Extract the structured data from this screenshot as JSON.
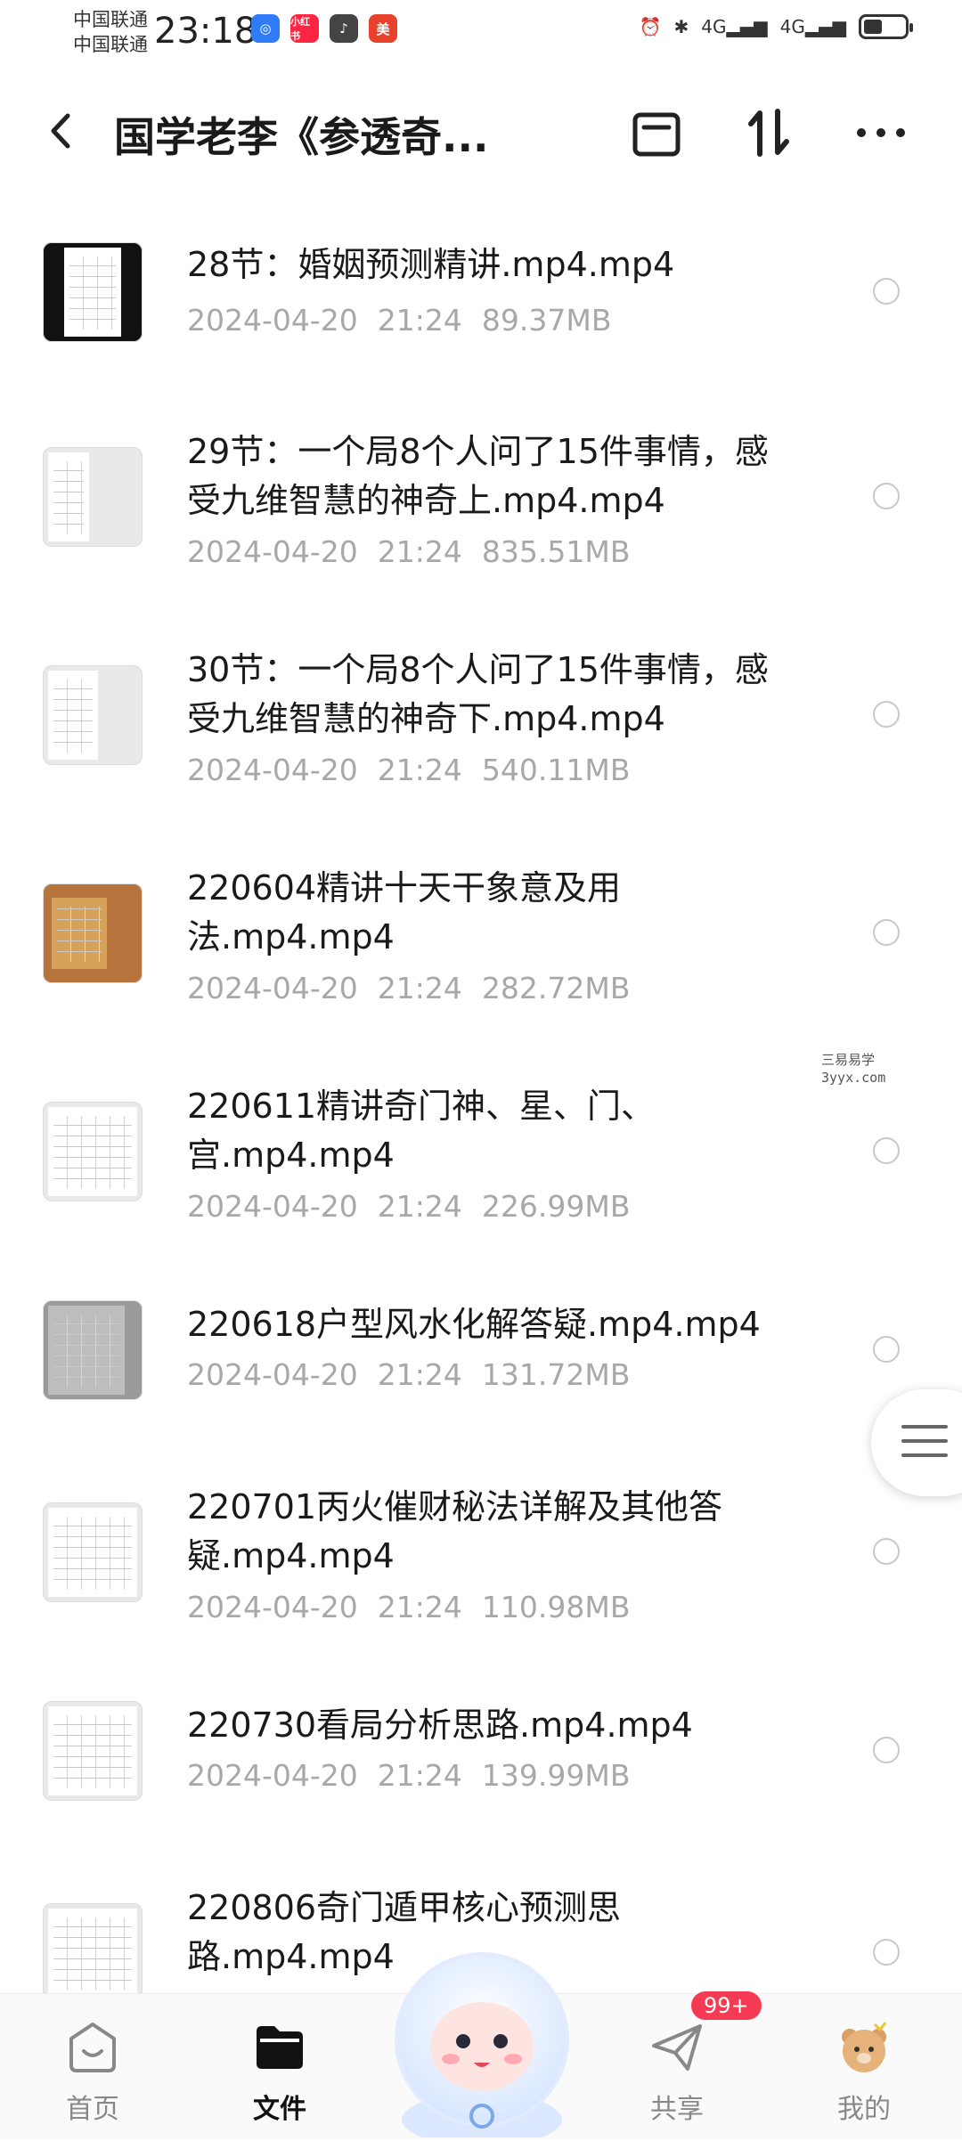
{
  "status_bar": {
    "carrier_1": "中国联通",
    "carrier_2": "中国联通",
    "time": "23:18",
    "app_badges": [
      "blue-app",
      "小红书",
      "tiktok-app",
      "美团"
    ],
    "net_1": "4G",
    "net_2": "4G"
  },
  "header": {
    "title": "国学老李《参透奇...",
    "icons": [
      "back-icon",
      "clipboard-icon",
      "sort-icon",
      "more-icon"
    ]
  },
  "files": [
    {
      "name": "28节：婚姻预测精讲.mp4.mp4",
      "date": "2024-04-20",
      "time": "21:24",
      "size": "89.37MB"
    },
    {
      "name": "29节：一个局8个人问了15件事情，感受九维智慧的神奇上.mp4.mp4",
      "date": "2024-04-20",
      "time": "21:24",
      "size": "835.51MB"
    },
    {
      "name": "30节：一个局8个人问了15件事情，感受九维智慧的神奇下.mp4.mp4",
      "date": "2024-04-20",
      "time": "21:24",
      "size": "540.11MB"
    },
    {
      "name": "220604精讲十天干象意及用法.mp4.mp4",
      "date": "2024-04-20",
      "time": "21:24",
      "size": "282.72MB"
    },
    {
      "name": "220611精讲奇门神、星、门、宫.mp4.mp4",
      "date": "2024-04-20",
      "time": "21:24",
      "size": "226.99MB"
    },
    {
      "name": "220618户型风水化解答疑.mp4.mp4",
      "date": "2024-04-20",
      "time": "21:24",
      "size": "131.72MB"
    },
    {
      "name": "220701丙火催财秘法详解及其他答疑.mp4.mp4",
      "date": "2024-04-20",
      "time": "21:24",
      "size": "110.98MB"
    },
    {
      "name": "220730看局分析思路.mp4.mp4",
      "date": "2024-04-20",
      "time": "21:24",
      "size": "139.99MB"
    },
    {
      "name": "220806奇门遁甲核心预测思路.mp4.mp4"
    }
  ],
  "watermark": {
    "line1": "三易易学",
    "line2": "3yyx.com"
  },
  "nav": {
    "home": "首页",
    "files": "文件",
    "share": "共享",
    "mine": "我的",
    "share_badge": "99+"
  },
  "colors": {
    "accent": "#111111",
    "badge": "#f43b53",
    "meta": "#a8a8a8"
  }
}
